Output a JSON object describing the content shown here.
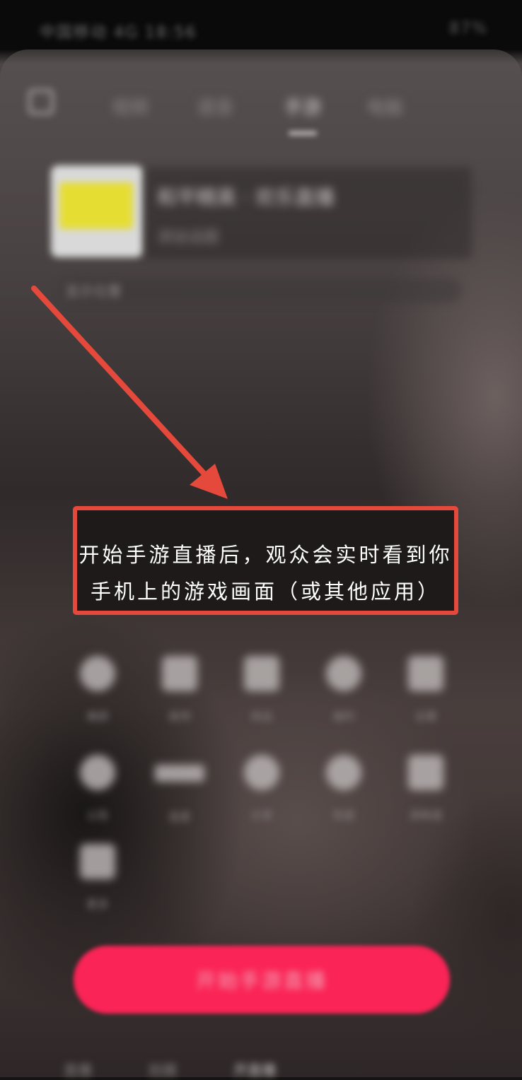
{
  "status_bar": {
    "left_text": "中国移动 4G 18:56",
    "right_text": "87%"
  },
  "tabs": {
    "items": [
      {
        "label": "视频"
      },
      {
        "label": "语音"
      },
      {
        "label": "手游"
      },
      {
        "label": "电脑"
      }
    ],
    "active_index": 2
  },
  "room": {
    "title": "和平精英 · 欢乐直播",
    "subtitle": "添加话题",
    "location": "显示位置"
  },
  "callout": {
    "line1": "开始手游直播后，观众会实时看到你",
    "line2": "手机上的游戏画面（或其他应用）"
  },
  "tools": [
    {
      "label": "美颜",
      "icon": "face-icon"
    },
    {
      "label": "装饰",
      "icon": "sticker-icon"
    },
    {
      "label": "商品",
      "icon": "cart-icon"
    },
    {
      "label": "福利",
      "icon": "gift-icon"
    },
    {
      "label": "设置",
      "icon": "settings-icon"
    },
    {
      "label": "公告",
      "icon": "notice-icon"
    },
    {
      "label": "连麦",
      "icon": "mic-icon"
    },
    {
      "label": "分享",
      "icon": "share-icon"
    },
    {
      "label": "热度",
      "icon": "fire-icon"
    },
    {
      "label": "清晰度",
      "icon": "hd-icon"
    },
    {
      "label": "更多",
      "icon": "more-icon"
    }
  ],
  "start_button": {
    "label": "开始手游直播"
  },
  "bottom_tabs": [
    {
      "label": "直播"
    },
    {
      "label": "拍摄"
    },
    {
      "label": "开直播"
    }
  ],
  "colors": {
    "accent": "#fa2456",
    "callout_border": "#e5493b",
    "callout_bg": "#1d1a19"
  }
}
